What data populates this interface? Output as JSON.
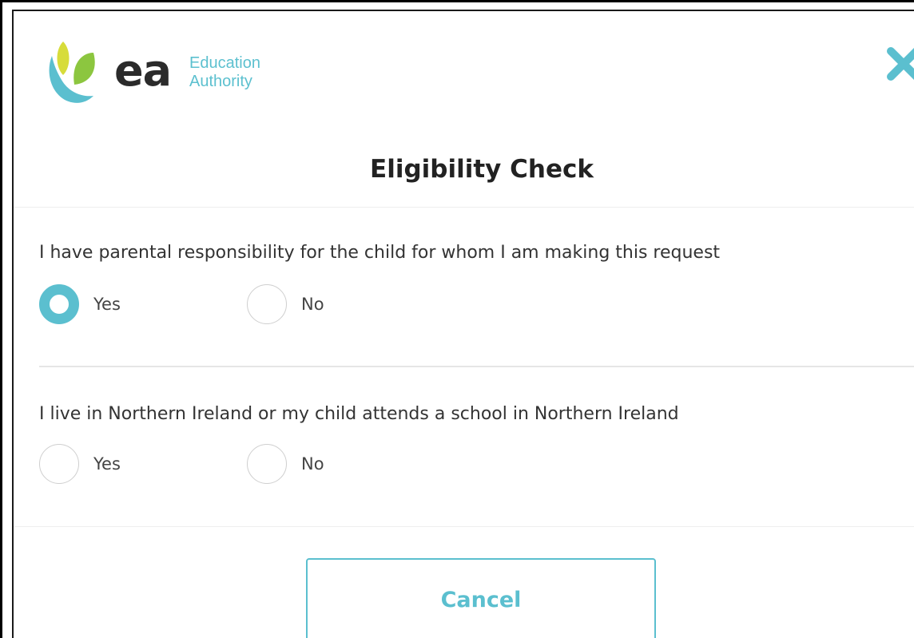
{
  "dialog": {
    "logo": {
      "mark": "ea",
      "text_line1": "Education",
      "text_line2": "Authority"
    },
    "close_icon": "close-icon",
    "title": "Eligibility Check",
    "questions": [
      {
        "text": "I have parental responsibility for the child for whom I am making this request",
        "options": [
          {
            "label": "Yes",
            "selected": true
          },
          {
            "label": "No",
            "selected": false
          }
        ]
      },
      {
        "text": "I live in Northern Ireland or my child attends a school in Northern Ireland",
        "options": [
          {
            "label": "Yes",
            "selected": false
          },
          {
            "label": "No",
            "selected": false
          }
        ]
      }
    ],
    "cancel_label": "Cancel"
  },
  "colors": {
    "accent": "#5bbfcf",
    "logo_green": "#8cc63f",
    "logo_yellow": "#d7dc3a",
    "text": "#333333"
  }
}
